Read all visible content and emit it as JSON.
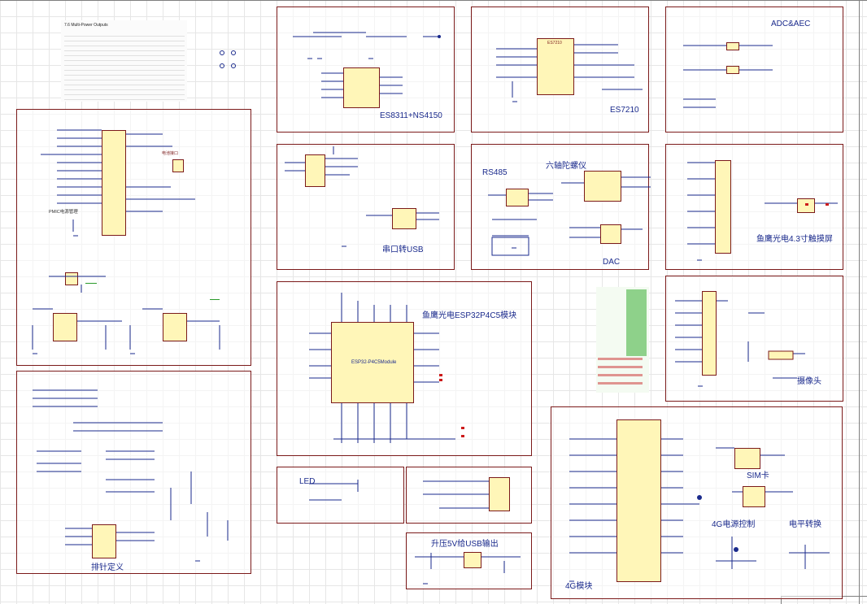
{
  "sheet": {
    "blocks": [
      {
        "id": "es8311",
        "title": "ES8311+NS4150"
      },
      {
        "id": "es7210",
        "title": "ES7210"
      },
      {
        "id": "adc",
        "title": "ADC&AEC"
      },
      {
        "id": "power",
        "title": "PMIC电源管理"
      },
      {
        "id": "usb",
        "title": "串口转USB"
      },
      {
        "id": "rs485",
        "title": "RS485"
      },
      {
        "id": "imu",
        "title": "六轴陀螺仪"
      },
      {
        "id": "dac",
        "title": "DAC"
      },
      {
        "id": "lcd",
        "title": "鱼鹰光电4.3寸触摸屏"
      },
      {
        "id": "esp32",
        "title": "鱼鹰光电ESP32P4C5模块"
      },
      {
        "id": "camera",
        "title": "摄像头"
      },
      {
        "id": "header",
        "title": "排针定义"
      },
      {
        "id": "led",
        "title": "LED"
      },
      {
        "id": "boost",
        "title": "升压5V给USB输出"
      },
      {
        "id": "sim",
        "title": "SIM卡"
      },
      {
        "id": "pwr4g",
        "title": "4G电源控制"
      },
      {
        "id": "level",
        "title": "电平转换"
      },
      {
        "id": "lte",
        "title": "4G模块"
      }
    ],
    "chip_labels": {
      "esp32_module": "ESP32-P4C5Module",
      "es7210_chip": "ES7210",
      "battery_port": "电池接口"
    },
    "note_table_title": "7.6 Multi-Power Outputs",
    "colors": {
      "border": "#7b1a1a",
      "label": "#1a2a8c",
      "chip_fill": "#fff6b8",
      "wire": "#1a2a8c",
      "net_red": "#cc1a1a"
    }
  }
}
